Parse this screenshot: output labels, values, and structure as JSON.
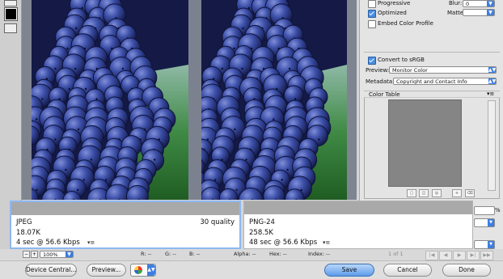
{
  "colors": {
    "accent": "#3d7ee0",
    "selected_border": "#8fb7f2",
    "color_table_fill": "#858585",
    "grape_dark": "#1f2a6b",
    "grape_mid": "#3c4fa8",
    "leaf_green": "#2e7a2e"
  },
  "tools": {
    "icons": [
      "eyedropper-icon",
      "foreground-color-icon",
      "toggle-slices-icon"
    ]
  },
  "settings": {
    "progressive_label": "Progressive",
    "progressive_checked": false,
    "blur_label": "Blur:",
    "blur_value": "0",
    "optimized_label": "Optimized",
    "optimized_checked": true,
    "matte_label": "Matte:",
    "embed_profile_label": "Embed Color Profile",
    "embed_profile_checked": false,
    "convert_srgb_label": "Convert to sRGB",
    "convert_srgb_checked": true,
    "preview_label": "Preview:",
    "preview_value": "Monitor Color",
    "metadata_label": "Metadata:",
    "metadata_value": "Copyright and Contact Info",
    "color_table_label": "Color Table",
    "color_table_icons": [
      "new-color-icon",
      "lock-icon",
      "web-shift-icon",
      "add-color-icon",
      "delete-icon"
    ]
  },
  "previews": {
    "left": {
      "format": "JPEG",
      "quality": "30 quality",
      "size": "18.07K",
      "time": "4 sec @ 56.6 Kbps"
    },
    "right": {
      "format": "PNG-24",
      "size": "258.5K",
      "time": "48 sec @ 56.6 Kbps"
    }
  },
  "status": {
    "zoom": "100%",
    "r": "R: --",
    "g": "G: --",
    "b": "B: --",
    "alpha": "Alpha: --",
    "hex": "Hex: --",
    "index": "Index: --",
    "frame": "1 of 1",
    "percent_sign": "%"
  },
  "buttons": {
    "device_central": "Device Central...",
    "preview": "Preview...",
    "save": "Save",
    "cancel": "Cancel",
    "done": "Done"
  }
}
